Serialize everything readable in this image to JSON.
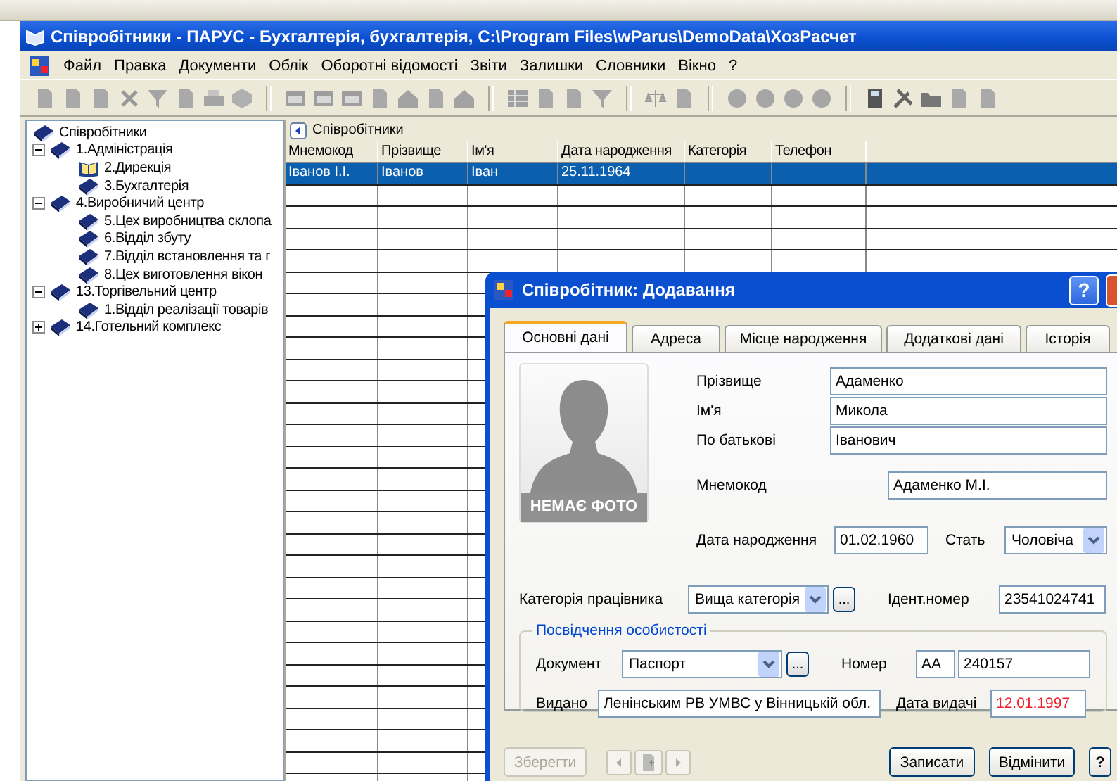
{
  "window": {
    "title": "Співробітники - ПАРУС - Бухгалтерія, бухгалтерія, C:\\Program Files\\wParus\\DemoData\\ХозРасчет"
  },
  "menu": [
    "Файл",
    "Правка",
    "Документи",
    "Облік",
    "Оборотні відомості",
    "Звіти",
    "Залишки",
    "Словники",
    "Вікно",
    "?"
  ],
  "tree": [
    {
      "label": "Співробітники",
      "selected": false,
      "children": [
        {
          "label": "1.Адміністрація",
          "selected": false,
          "expanded": true,
          "children": [
            {
              "label": "2.Дирекція",
              "selected": true
            },
            {
              "label": "3.Бухгалтерія",
              "selected": false
            }
          ]
        },
        {
          "label": "4.Виробничий центр",
          "selected": false,
          "expanded": true,
          "children": [
            {
              "label": "5.Цех виробництва склопа",
              "selected": false
            },
            {
              "label": "6.Відділ збуту",
              "selected": false
            },
            {
              "label": "7.Відділ встановлення та г",
              "selected": false
            },
            {
              "label": "8.Цех виготовлення вікон",
              "selected": false
            }
          ]
        },
        {
          "label": "13.Торгівельний центр",
          "selected": false,
          "expanded": true,
          "children": [
            {
              "label": "1.Відділ реалізації товарів",
              "selected": false
            }
          ]
        },
        {
          "label": "14.Готельний комплекс",
          "selected": false,
          "expanded": false
        }
      ]
    }
  ],
  "grid": {
    "title": "Співробітники",
    "columns": [
      "Мнемокод",
      "Прізвище",
      "Ім'я",
      "Дата народження",
      "Категорія",
      "Телефон"
    ],
    "rows": [
      {
        "cells": [
          "Іванов І.І.",
          "Іванов",
          "Іван",
          "25.11.1964"
        ],
        "selected": true
      }
    ]
  },
  "dialog": {
    "title": "Співробітник: Додавання",
    "help": "?",
    "tabs": [
      {
        "label": "Основні дані",
        "selected": true
      },
      {
        "label": "Адреса",
        "selected": false
      },
      {
        "label": "Місце народження",
        "selected": false
      },
      {
        "label": "Додаткові дані",
        "selected": false
      },
      {
        "label": "Історія",
        "selected": false
      }
    ],
    "photo_caption": "НЕМАЄ ФОТО",
    "name_fields": [
      {
        "label": "Прізвище",
        "value": "Адаменко"
      },
      {
        "label": "Ім'я",
        "value": "Микола"
      },
      {
        "label": "По батькові",
        "value": "Іванович"
      }
    ],
    "mnemocode": {
      "label": "Мнемокод",
      "value": "Адаменко М.І."
    },
    "birth_date": {
      "label": "Дата народження",
      "value": "01.02.1960"
    },
    "sex": {
      "label": "Стать",
      "value": "Чоловіча"
    },
    "category": {
      "label": "Категорія працівника",
      "value": "Вища категорія",
      "button": "..."
    },
    "id_number": {
      "label": "Ідент.номер",
      "value": "23541024741"
    },
    "id_doc": {
      "legend": "Посвідчення особистості",
      "document": {
        "label": "Документ",
        "value": "Паспорт",
        "button": "..."
      },
      "number": {
        "label": "Номер",
        "series": "АА",
        "value": "240157"
      },
      "issued_by": {
        "label": "Видано",
        "value": "Ленінським РВ УМВС у Вінницькій обл."
      },
      "issue_date": {
        "label": "Дата видачі",
        "value": "12.01.1997",
        "invalid": true
      }
    },
    "save_button": {
      "label": "Зберегти",
      "disabled": true
    },
    "buttons": [
      {
        "label": "Записати"
      },
      {
        "label": "Відмінити"
      },
      {
        "label": "?"
      }
    ]
  }
}
